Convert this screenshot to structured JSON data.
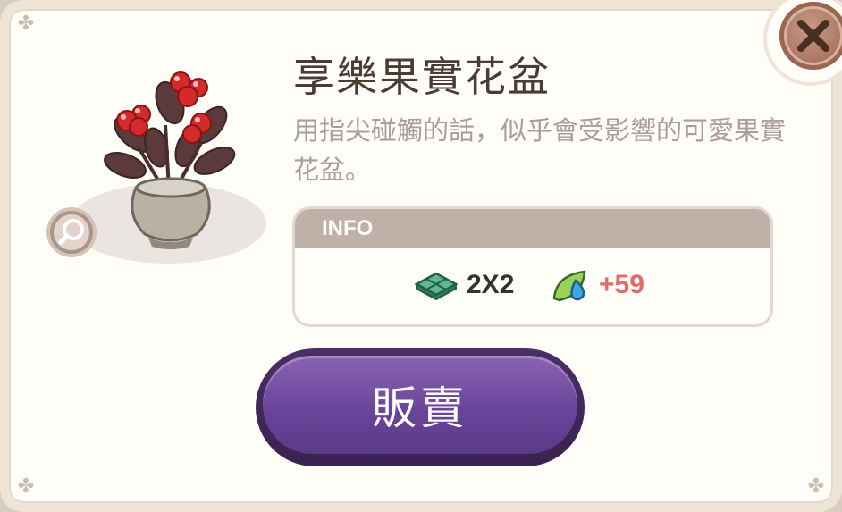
{
  "item": {
    "title": "享樂果實花盆",
    "description": "用指尖碰觸的話，似乎會受影響的可愛果實花盆。",
    "image_icon": "red-berry-flowerpot-icon"
  },
  "info": {
    "header": "INFO",
    "size": "2X2",
    "bonus": "+59",
    "size_icon": "tile-size-icon",
    "bonus_icon": "leaf-drop-icon"
  },
  "actions": {
    "sell_label": "販賣",
    "close_icon": "close-icon",
    "zoom_icon": "magnifier-icon"
  },
  "colors": {
    "title": "#4a3b35",
    "description": "#aa9c97",
    "bonus": "#e36a6a",
    "sell_button": "#6a459a",
    "close_button": "#a97460"
  }
}
